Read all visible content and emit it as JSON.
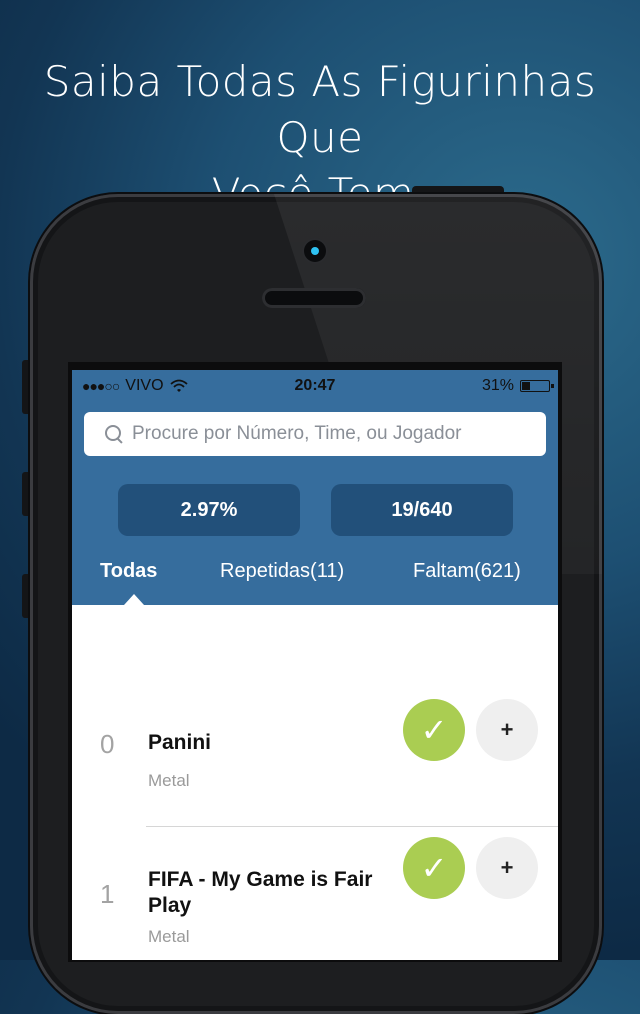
{
  "headline": {
    "line1": "Saiba Todas As Figurinhas Que",
    "line2": "Você Tem."
  },
  "status_bar": {
    "signal": "●●●○○",
    "carrier": "VIVO",
    "time": "20:47",
    "battery": "31%",
    "battery_level": 0.31
  },
  "search": {
    "placeholder": "Procure por Número, Time, ou Jogador"
  },
  "stats": {
    "percent": "2.97%",
    "count": "19/640"
  },
  "tabs": [
    {
      "label": "Todas",
      "active": true
    },
    {
      "label": "Repetidas(11)",
      "active": false
    },
    {
      "label": "Faltam(621)",
      "active": false
    }
  ],
  "stickers": [
    {
      "number": "0",
      "title": "Panini",
      "type": "Metal",
      "owned": true
    },
    {
      "number": "1",
      "title": "FIFA - My Game is Fair Play",
      "type": "Metal",
      "owned": true
    }
  ],
  "icons": {
    "check": "✓",
    "plus": "+"
  },
  "colors": {
    "header_blue": "#366d9d",
    "stat_blue": "#22507a",
    "check_green": "#aacd52"
  }
}
